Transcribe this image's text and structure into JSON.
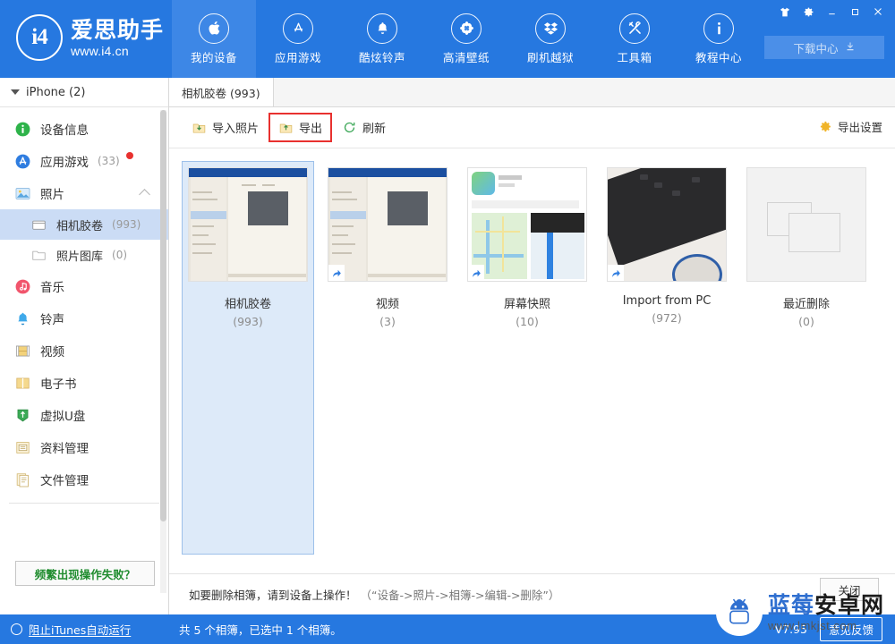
{
  "app": {
    "brand_cn": "爱思助手",
    "brand_url": "www.i4.cn",
    "logo_mark": "i4"
  },
  "topnav": {
    "items": [
      {
        "label": "我的设备",
        "icon": "apple-icon",
        "active": true
      },
      {
        "label": "应用游戏",
        "icon": "appstore-icon",
        "active": false
      },
      {
        "label": "酷炫铃声",
        "icon": "bell-icon",
        "active": false
      },
      {
        "label": "高清壁纸",
        "icon": "flower-icon",
        "active": false
      },
      {
        "label": "刷机越狱",
        "icon": "dropbox-icon",
        "active": false
      },
      {
        "label": "工具箱",
        "icon": "tools-icon",
        "active": false
      },
      {
        "label": "教程中心",
        "icon": "info-icon",
        "active": false
      }
    ],
    "download_center": "下载中心"
  },
  "window_controls": [
    {
      "name": "skin-icon",
      "glyph": "skin"
    },
    {
      "name": "settings-gear-icon",
      "glyph": "gear"
    },
    {
      "name": "minimize-icon",
      "glyph": "minimize"
    },
    {
      "name": "maximize-icon",
      "glyph": "maximize"
    },
    {
      "name": "close-icon",
      "glyph": "close"
    }
  ],
  "sidebar": {
    "device_header": "iPhone (2)",
    "items": [
      {
        "label": "设备信息",
        "count": "",
        "icon": "info-green-icon",
        "level": 0,
        "selected": false,
        "badge": false
      },
      {
        "label": "应用游戏",
        "count": "(33)",
        "icon": "appstore-blue-icon",
        "level": 0,
        "selected": false,
        "badge": true
      },
      {
        "label": "照片",
        "count": "",
        "icon": "photos-icon",
        "level": 0,
        "selected": false,
        "badge": false,
        "expanded": true
      },
      {
        "label": "相机胶卷",
        "count": "(993)",
        "icon": "camera-roll-icon",
        "level": 1,
        "selected": true,
        "badge": false
      },
      {
        "label": "照片图库",
        "count": "(0)",
        "icon": "photo-library-icon",
        "level": 1,
        "selected": false,
        "badge": false
      },
      {
        "label": "音乐",
        "count": "",
        "icon": "music-icon",
        "level": 0,
        "selected": false,
        "badge": false
      },
      {
        "label": "铃声",
        "count": "",
        "icon": "ringtone-bell-icon",
        "level": 0,
        "selected": false,
        "badge": false
      },
      {
        "label": "视频",
        "count": "",
        "icon": "video-film-icon",
        "level": 0,
        "selected": false,
        "badge": false
      },
      {
        "label": "电子书",
        "count": "",
        "icon": "ebook-icon",
        "level": 0,
        "selected": false,
        "badge": false
      },
      {
        "label": "虚拟U盘",
        "count": "",
        "icon": "usb-drive-icon",
        "level": 0,
        "selected": false,
        "badge": false
      },
      {
        "label": "资料管理",
        "count": "",
        "icon": "data-manage-icon",
        "level": 0,
        "selected": false,
        "badge": false
      },
      {
        "label": "文件管理",
        "count": "",
        "icon": "file-manage-icon",
        "level": 0,
        "selected": false,
        "badge": false
      }
    ],
    "fail_button": "频繁出现操作失败？"
  },
  "main": {
    "tab_label": "相机胶卷 (993)",
    "toolbar": {
      "import_label": "导入照片",
      "export_label": "导出",
      "refresh_label": "刷新",
      "export_settings_label": "导出设置",
      "highlight_color": "#e8312f"
    },
    "albums": [
      {
        "title": "相机胶卷",
        "count": "(993)",
        "thumb": "pc-desk-photo",
        "selected": true,
        "has_corner": false
      },
      {
        "title": "视频",
        "count": "(3)",
        "thumb": "pc-desk-photo",
        "selected": false,
        "has_corner": true
      },
      {
        "title": "屏幕快照",
        "count": "(10)",
        "thumb": "map-screenshot",
        "selected": false,
        "has_corner": true
      },
      {
        "title": "Import from PC",
        "count": "(972)",
        "thumb": "keyboard-mouse",
        "selected": false,
        "has_corner": true
      },
      {
        "title": "最近删除",
        "count": "(0)",
        "thumb": "empty-placeholder",
        "selected": false,
        "has_corner": false
      }
    ],
    "hint_main": "如要删除相簿，请到设备上操作！",
    "hint_sub": "（“设备->照片->相簿->编辑->删除”）",
    "close_button": "关闭"
  },
  "statusbar": {
    "itunes_toggle": "阻止iTunes自动运行",
    "summary": "共 5 个相簿，已选中 1 个相簿。",
    "version": "V7.95",
    "feedback": "意见反馈"
  },
  "watermark": {
    "cn_blue": "蓝莓",
    "cn_dark": "安卓网",
    "url": "www.lmkjst.com"
  },
  "colors": {
    "brand_blue": "#2678e0",
    "nav_active": "#3d87e6",
    "selected_row": "#cbdcf5",
    "selected_card": "#ddeaf9",
    "alert_red": "#e8312f",
    "green_text": "#1f8c2e"
  }
}
